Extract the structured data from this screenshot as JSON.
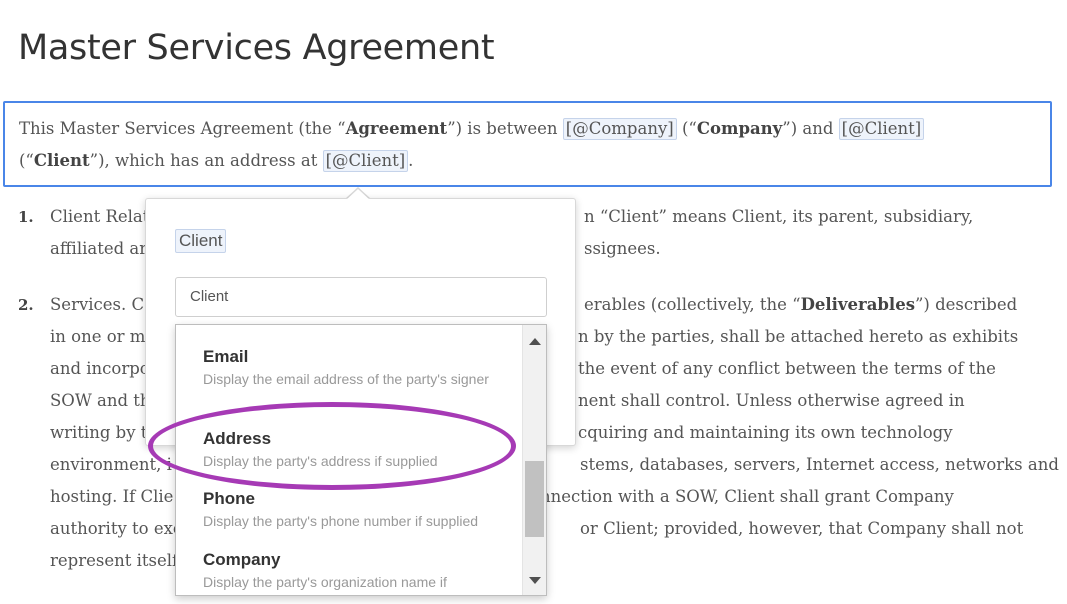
{
  "page": {
    "title": "Master Services Agreement"
  },
  "intro": {
    "t1": "This Master Services Agreement (the “",
    "b1": "Agreement",
    "t2": "”) is between ",
    "tok1": "[@Company]",
    "t3": " (“",
    "b2": "Company",
    "t4": "”) and ",
    "tok2": "[@Client]",
    "t5": "(“",
    "b3": "Client",
    "t6": "”), which has an address at ",
    "tok3": "[@Client]",
    "t7": "."
  },
  "clauses": [
    {
      "num": "1.",
      "lines": [
        {
          "a": "Client Relat",
          "b": "n “Client” means Client, its parent, subsidiary,"
        },
        {
          "a": "affiliated ar",
          "b": "ssignees."
        }
      ]
    },
    {
      "num": "2.",
      "lines": [
        {
          "a": "Services. Co",
          "b1": "erables (collectively, the “",
          "bold": "Deliverables",
          "b2": "”) described"
        },
        {
          "a": "in one or m",
          "b": "n by the parties, shall be attached hereto as exhibits"
        },
        {
          "a": "and incorpo",
          "b": "the event of any conflict between the terms of the"
        },
        {
          "a": "SOW and th",
          "b": "nent shall control.  Unless otherwise agreed in"
        },
        {
          "a": "writing by t",
          "b": "cquiring and maintaining its own technology"
        },
        {
          "a": "environment, i",
          "b": "stems, databases, servers, Internet access, networks and"
        },
        {
          "a": "hosting.  If Clie",
          "b": "nnection with a SOW, Client shall grant Company"
        },
        {
          "a": "authority to exe",
          "b": "or Client; provided, however, that Company shall not"
        },
        {
          "a": "represent itself",
          "b": ""
        }
      ]
    }
  ],
  "popover": {
    "token": "Client",
    "input_value": "Client"
  },
  "dropdown": {
    "items": [
      {
        "label": "Email",
        "desc": "Display the email address of the party's signer"
      },
      {
        "label": "Address",
        "desc": "Display the party's address if supplied"
      },
      {
        "label": "Phone",
        "desc": "Display the party's phone number if supplied"
      },
      {
        "label": "Company",
        "desc": "Display the party's organization name if"
      }
    ]
  },
  "colors": {
    "accent": "#4a86e8",
    "annotation": "#a63ab5"
  }
}
